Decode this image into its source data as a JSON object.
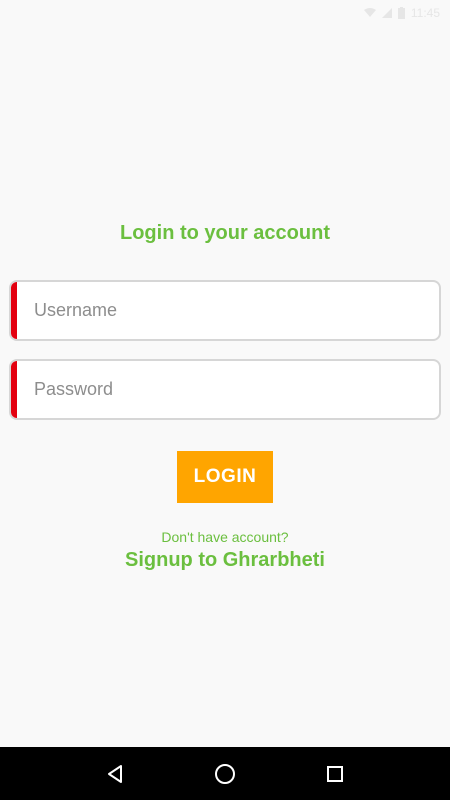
{
  "status_bar": {
    "time": "11:45",
    "icons": [
      "wifi-icon",
      "signal-icon",
      "battery-icon"
    ]
  },
  "login": {
    "title": "Login to your account",
    "username_placeholder": "Username",
    "password_placeholder": "Password",
    "button_label": "LOGIN",
    "hint": "Don't have account?",
    "signup_link": "Signup to Ghrarbheti"
  },
  "nav_bar": {
    "icons": [
      "back-icon",
      "home-icon",
      "recents-icon"
    ]
  },
  "colors": {
    "accent_green": "#6bbf3f",
    "button_orange": "#ffa500",
    "field_marker_red": "#e3000f",
    "background": "#f9f9f9"
  }
}
